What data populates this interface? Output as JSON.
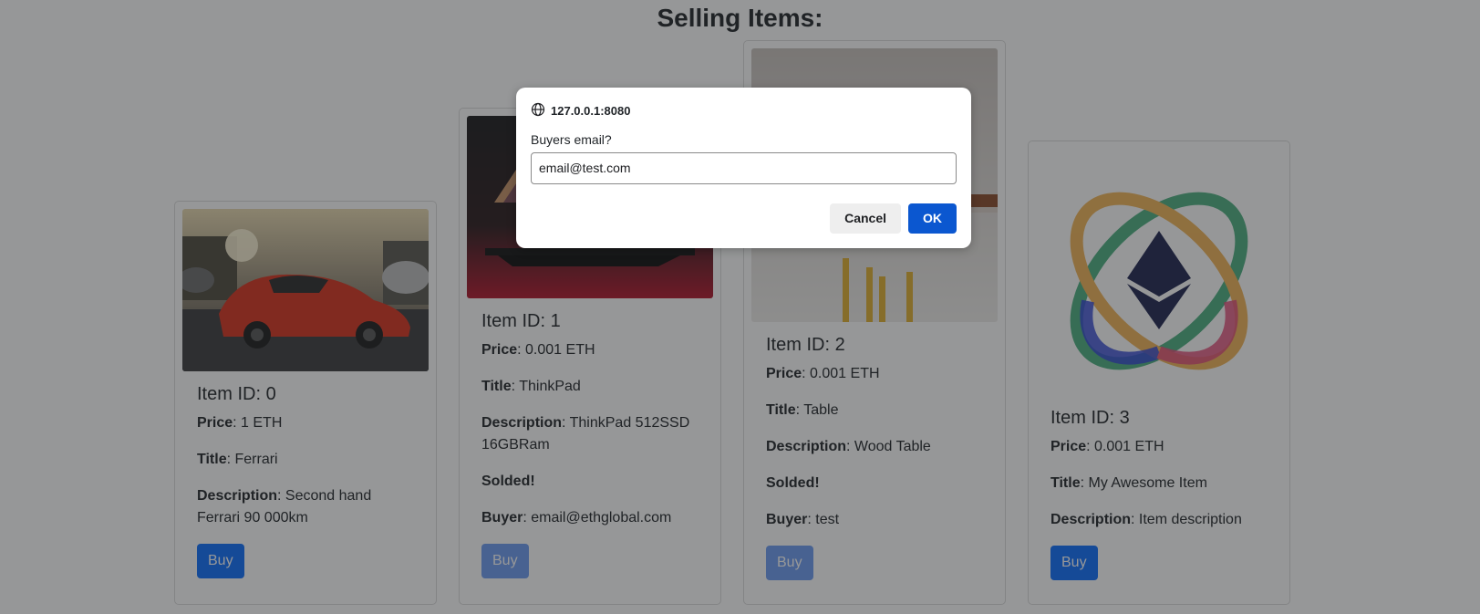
{
  "page": {
    "title": "Selling Items:"
  },
  "labels": {
    "price": "Price",
    "title": "Title",
    "description": "Description",
    "buyer": "Buyer",
    "sold": "Solded!",
    "buy": "Buy",
    "separator": ": "
  },
  "items": [
    {
      "id_label": "Item ID: 0",
      "price": "1 ETH",
      "title": "Ferrari",
      "description": "Second hand Ferrari 90 000km",
      "image": "red-ferrari-car-photo"
    },
    {
      "id_label": "Item ID: 1",
      "price": "0.001 ETH",
      "title": "ThinkPad",
      "description": "ThinkPad 512SSD 16GBRam",
      "buyer": "email@ethglobal.com",
      "image": "laptop-photo"
    },
    {
      "id_label": "Item ID: 2",
      "price": "0.001 ETH",
      "title": "Table",
      "description": "Wood Table",
      "buyer": "test",
      "image": "wood-table-photo"
    },
    {
      "id_label": "Item ID: 3",
      "price": "0.001 ETH",
      "title": "My Awesome Item",
      "description": "Item description",
      "image": "ethereum-logo"
    }
  ],
  "dialog": {
    "origin": "127.0.0.1:8080",
    "message": "Buyers email?",
    "input_value": "email@test.com",
    "cancel_label": "Cancel",
    "ok_label": "OK",
    "icon": "globe-icon"
  },
  "colors": {
    "primary": "#0d6efd",
    "ok_button": "#0b57d0",
    "overlay": "rgba(32,33,36,0.47)"
  }
}
